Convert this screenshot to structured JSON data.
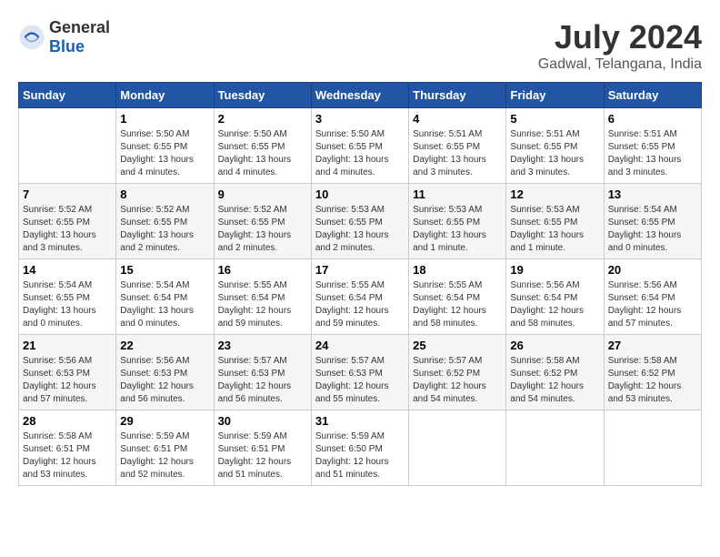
{
  "header": {
    "logo_general": "General",
    "logo_blue": "Blue",
    "title": "July 2024",
    "location": "Gadwal, Telangana, India"
  },
  "calendar": {
    "days_of_week": [
      "Sunday",
      "Monday",
      "Tuesday",
      "Wednesday",
      "Thursday",
      "Friday",
      "Saturday"
    ],
    "weeks": [
      [
        {
          "date": "",
          "sunrise": "",
          "sunset": "",
          "daylight": ""
        },
        {
          "date": "1",
          "sunrise": "Sunrise: 5:50 AM",
          "sunset": "Sunset: 6:55 PM",
          "daylight": "Daylight: 13 hours and 4 minutes."
        },
        {
          "date": "2",
          "sunrise": "Sunrise: 5:50 AM",
          "sunset": "Sunset: 6:55 PM",
          "daylight": "Daylight: 13 hours and 4 minutes."
        },
        {
          "date": "3",
          "sunrise": "Sunrise: 5:50 AM",
          "sunset": "Sunset: 6:55 PM",
          "daylight": "Daylight: 13 hours and 4 minutes."
        },
        {
          "date": "4",
          "sunrise": "Sunrise: 5:51 AM",
          "sunset": "Sunset: 6:55 PM",
          "daylight": "Daylight: 13 hours and 3 minutes."
        },
        {
          "date": "5",
          "sunrise": "Sunrise: 5:51 AM",
          "sunset": "Sunset: 6:55 PM",
          "daylight": "Daylight: 13 hours and 3 minutes."
        },
        {
          "date": "6",
          "sunrise": "Sunrise: 5:51 AM",
          "sunset": "Sunset: 6:55 PM",
          "daylight": "Daylight: 13 hours and 3 minutes."
        }
      ],
      [
        {
          "date": "7",
          "sunrise": "Sunrise: 5:52 AM",
          "sunset": "Sunset: 6:55 PM",
          "daylight": "Daylight: 13 hours and 3 minutes."
        },
        {
          "date": "8",
          "sunrise": "Sunrise: 5:52 AM",
          "sunset": "Sunset: 6:55 PM",
          "daylight": "Daylight: 13 hours and 2 minutes."
        },
        {
          "date": "9",
          "sunrise": "Sunrise: 5:52 AM",
          "sunset": "Sunset: 6:55 PM",
          "daylight": "Daylight: 13 hours and 2 minutes."
        },
        {
          "date": "10",
          "sunrise": "Sunrise: 5:53 AM",
          "sunset": "Sunset: 6:55 PM",
          "daylight": "Daylight: 13 hours and 2 minutes."
        },
        {
          "date": "11",
          "sunrise": "Sunrise: 5:53 AM",
          "sunset": "Sunset: 6:55 PM",
          "daylight": "Daylight: 13 hours and 1 minute."
        },
        {
          "date": "12",
          "sunrise": "Sunrise: 5:53 AM",
          "sunset": "Sunset: 6:55 PM",
          "daylight": "Daylight: 13 hours and 1 minute."
        },
        {
          "date": "13",
          "sunrise": "Sunrise: 5:54 AM",
          "sunset": "Sunset: 6:55 PM",
          "daylight": "Daylight: 13 hours and 0 minutes."
        }
      ],
      [
        {
          "date": "14",
          "sunrise": "Sunrise: 5:54 AM",
          "sunset": "Sunset: 6:55 PM",
          "daylight": "Daylight: 13 hours and 0 minutes."
        },
        {
          "date": "15",
          "sunrise": "Sunrise: 5:54 AM",
          "sunset": "Sunset: 6:54 PM",
          "daylight": "Daylight: 13 hours and 0 minutes."
        },
        {
          "date": "16",
          "sunrise": "Sunrise: 5:55 AM",
          "sunset": "Sunset: 6:54 PM",
          "daylight": "Daylight: 12 hours and 59 minutes."
        },
        {
          "date": "17",
          "sunrise": "Sunrise: 5:55 AM",
          "sunset": "Sunset: 6:54 PM",
          "daylight": "Daylight: 12 hours and 59 minutes."
        },
        {
          "date": "18",
          "sunrise": "Sunrise: 5:55 AM",
          "sunset": "Sunset: 6:54 PM",
          "daylight": "Daylight: 12 hours and 58 minutes."
        },
        {
          "date": "19",
          "sunrise": "Sunrise: 5:56 AM",
          "sunset": "Sunset: 6:54 PM",
          "daylight": "Daylight: 12 hours and 58 minutes."
        },
        {
          "date": "20",
          "sunrise": "Sunrise: 5:56 AM",
          "sunset": "Sunset: 6:54 PM",
          "daylight": "Daylight: 12 hours and 57 minutes."
        }
      ],
      [
        {
          "date": "21",
          "sunrise": "Sunrise: 5:56 AM",
          "sunset": "Sunset: 6:53 PM",
          "daylight": "Daylight: 12 hours and 57 minutes."
        },
        {
          "date": "22",
          "sunrise": "Sunrise: 5:56 AM",
          "sunset": "Sunset: 6:53 PM",
          "daylight": "Daylight: 12 hours and 56 minutes."
        },
        {
          "date": "23",
          "sunrise": "Sunrise: 5:57 AM",
          "sunset": "Sunset: 6:53 PM",
          "daylight": "Daylight: 12 hours and 56 minutes."
        },
        {
          "date": "24",
          "sunrise": "Sunrise: 5:57 AM",
          "sunset": "Sunset: 6:53 PM",
          "daylight": "Daylight: 12 hours and 55 minutes."
        },
        {
          "date": "25",
          "sunrise": "Sunrise: 5:57 AM",
          "sunset": "Sunset: 6:52 PM",
          "daylight": "Daylight: 12 hours and 54 minutes."
        },
        {
          "date": "26",
          "sunrise": "Sunrise: 5:58 AM",
          "sunset": "Sunset: 6:52 PM",
          "daylight": "Daylight: 12 hours and 54 minutes."
        },
        {
          "date": "27",
          "sunrise": "Sunrise: 5:58 AM",
          "sunset": "Sunset: 6:52 PM",
          "daylight": "Daylight: 12 hours and 53 minutes."
        }
      ],
      [
        {
          "date": "28",
          "sunrise": "Sunrise: 5:58 AM",
          "sunset": "Sunset: 6:51 PM",
          "daylight": "Daylight: 12 hours and 53 minutes."
        },
        {
          "date": "29",
          "sunrise": "Sunrise: 5:59 AM",
          "sunset": "Sunset: 6:51 PM",
          "daylight": "Daylight: 12 hours and 52 minutes."
        },
        {
          "date": "30",
          "sunrise": "Sunrise: 5:59 AM",
          "sunset": "Sunset: 6:51 PM",
          "daylight": "Daylight: 12 hours and 51 minutes."
        },
        {
          "date": "31",
          "sunrise": "Sunrise: 5:59 AM",
          "sunset": "Sunset: 6:50 PM",
          "daylight": "Daylight: 12 hours and 51 minutes."
        },
        {
          "date": "",
          "sunrise": "",
          "sunset": "",
          "daylight": ""
        },
        {
          "date": "",
          "sunrise": "",
          "sunset": "",
          "daylight": ""
        },
        {
          "date": "",
          "sunrise": "",
          "sunset": "",
          "daylight": ""
        }
      ]
    ]
  }
}
